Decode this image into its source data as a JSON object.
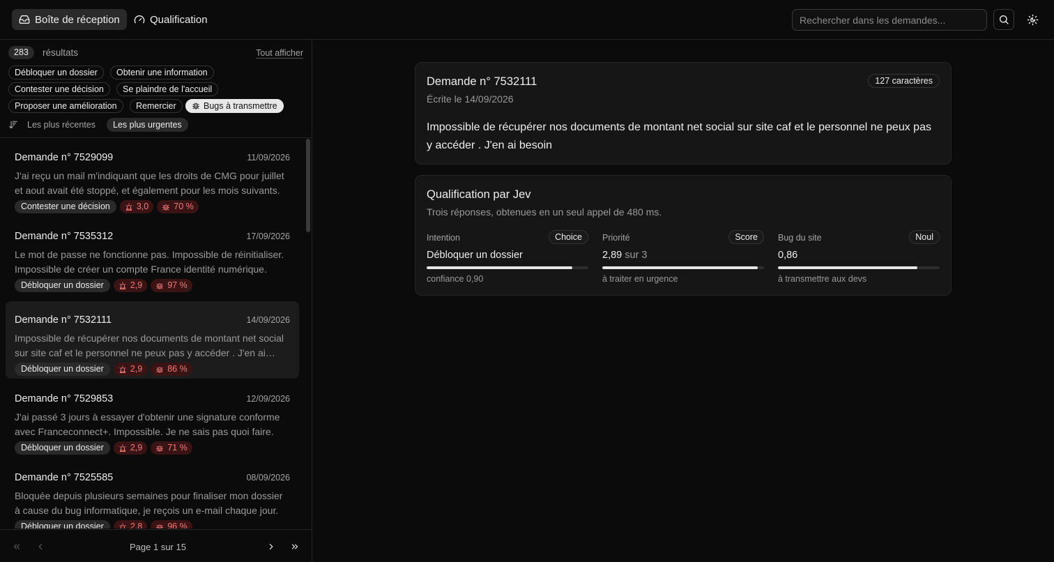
{
  "topbar": {
    "inbox_label": "Boîte de réception",
    "qualification_label": "Qualification",
    "search_placeholder": "Rechercher dans les demandes..."
  },
  "filters": {
    "count": "283",
    "results_label": "résultats",
    "show_all": "Tout afficher",
    "chips": [
      "Débloquer un dossier",
      "Obtenir une information",
      "Contester une décision",
      "Se plaindre de l'accueil",
      "Proposer une amélioration",
      "Remercier",
      "Bugs à transmettre"
    ],
    "sort": [
      "Les plus récentes",
      "Les plus urgentes"
    ]
  },
  "list": [
    {
      "title": "Demande n° 7529099",
      "date": "11/09/2026",
      "text": "J'ai reçu un mail m'indiquant que les droits de CMG pour juillet et aout avait été stoppé, et également pour les mois suivants.",
      "intent": "Contester une décision",
      "priority": "3,0",
      "bug": "70 %"
    },
    {
      "title": "Demande n° 7535312",
      "date": "17/09/2026",
      "text": "Le mot de passe ne fonctionne pas. Impossible de réinitialiser. Impossible de créer un compte France identité numérique.",
      "intent": "Débloquer un dossier",
      "priority": "2,9",
      "bug": "97 %"
    },
    {
      "title": "Demande n° 7532111",
      "date": "14/09/2026",
      "text": "Impossible de récupérer nos documents de montant net social sur site caf et le personnel ne peux pas y accéder . J'en ai besoin",
      "intent": "Débloquer un dossier",
      "priority": "2,9",
      "bug": "86 %"
    },
    {
      "title": "Demande n° 7529853",
      "date": "12/09/2026",
      "text": "J'ai passé 3 jours à essayer d'obtenir une signature conforme avec Franceconnect+. Impossible. Je ne sais pas quoi faire.",
      "intent": "Débloquer un dossier",
      "priority": "2,9",
      "bug": "71 %"
    },
    {
      "title": "Demande n° 7525585",
      "date": "08/09/2026",
      "text": "Bloquée depuis plusieurs semaines pour finaliser mon dossier à cause du bug informatique, je reçois un e-mail chaque jour.",
      "intent": "Débloquer un dossier",
      "priority": "2,8",
      "bug": "96 %"
    }
  ],
  "pager": {
    "label": "Page 1 sur 15"
  },
  "detail": {
    "title": "Demande n° 7532111",
    "date_line": "Écrite le 14/09/2026",
    "chars": "127 caractères",
    "body": "Impossible de récupérer nos documents de montant net social sur site caf et le personnel ne peux pas y accéder . J'en ai besoin"
  },
  "qualification": {
    "title": "Qualification par Jev",
    "subtitle": "Trois réponses, obtenues en un seul appel de 480 ms.",
    "metrics": [
      {
        "label": "Intention",
        "badge": "Choice",
        "value": "Débloquer un dossier",
        "suffix": "",
        "note": "confiance 0,90",
        "level": 0.9
      },
      {
        "label": "Priorité",
        "badge": "Score",
        "value": "2,89",
        "suffix": "sur 3",
        "note": "à traiter en urgence",
        "level": 0.963
      },
      {
        "label": "Bug du site",
        "badge": "Noul",
        "value": "0,86",
        "suffix": "",
        "note": "à transmettre aux devs",
        "level": 0.86
      }
    ]
  },
  "colors": {
    "accent_red": "#f07a7a",
    "red_bg": "#3a1414",
    "background": "#0b0b0b"
  },
  "icons": [
    "inbox-icon",
    "gauge-icon",
    "search-icon",
    "theme-toggle-icon",
    "bug-icon",
    "siren-icon",
    "sort-icon",
    "chevrons-left-icon",
    "chevron-left-icon",
    "chevron-right-icon",
    "chevrons-right-icon"
  ]
}
